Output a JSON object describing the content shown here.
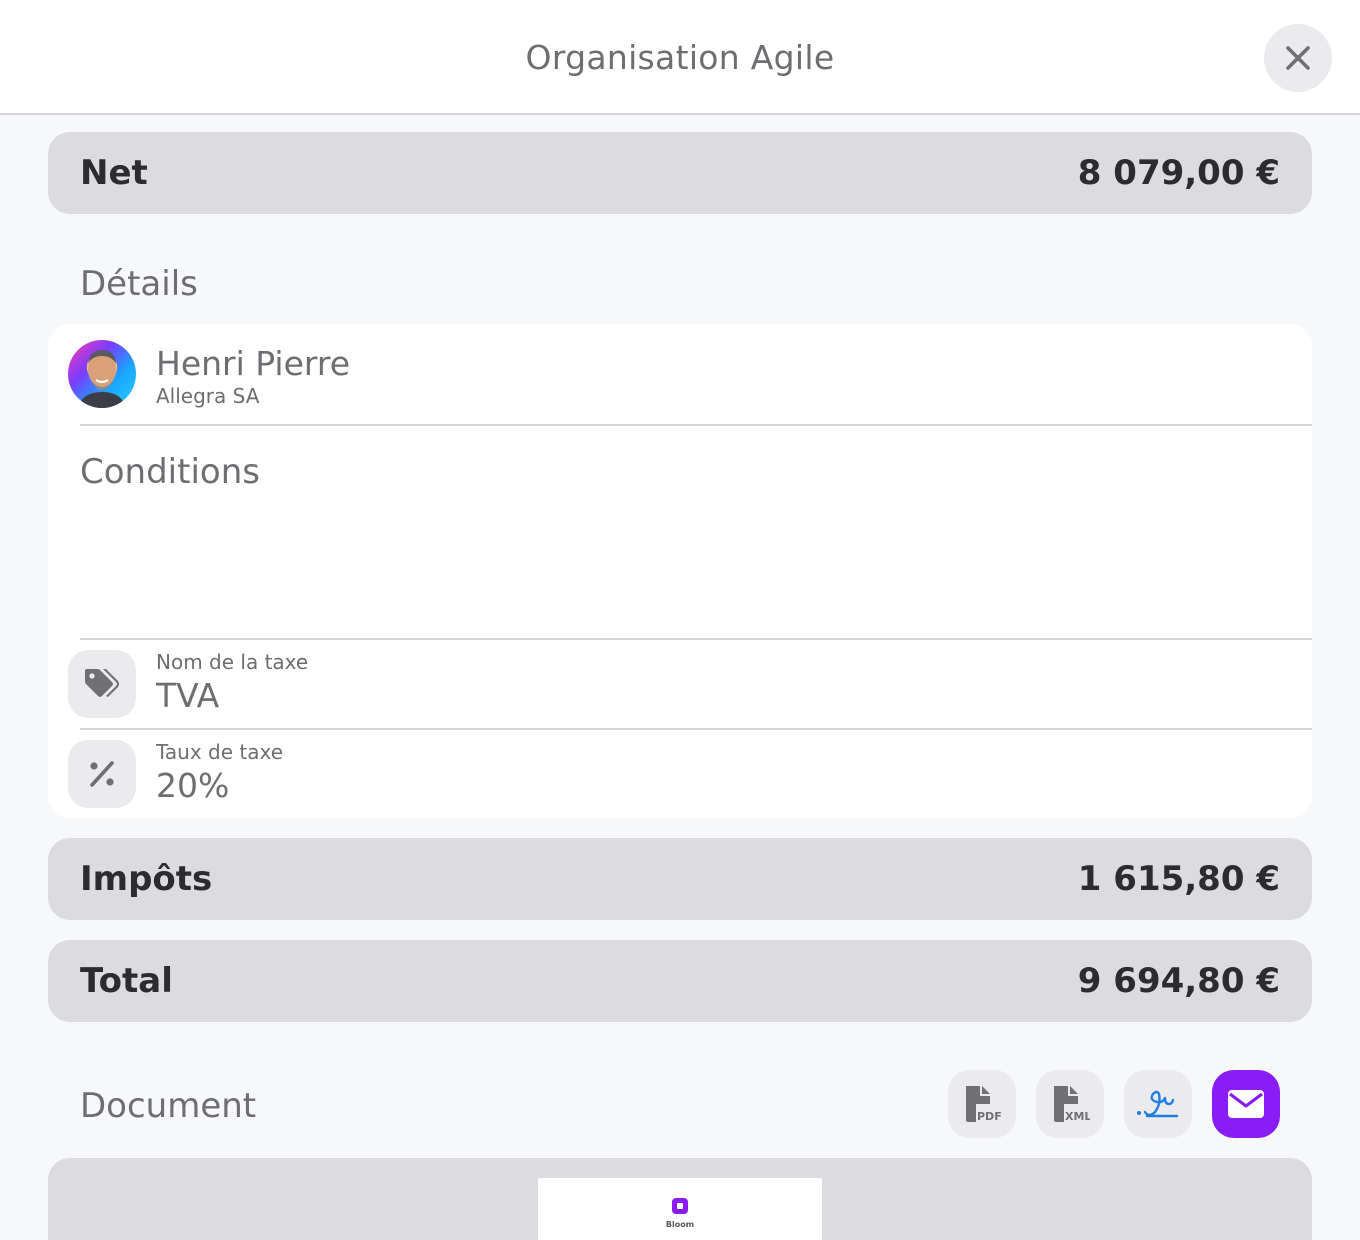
{
  "header": {
    "title": "Organisation Agile",
    "close_icon": "close-icon"
  },
  "net": {
    "label": "Net",
    "value": "8 079,00 €"
  },
  "details": {
    "title": "Détails",
    "contact": {
      "name": "Henri Pierre",
      "company": "Allegra SA"
    },
    "conditions_label": "Conditions",
    "tax_name": {
      "label": "Nom de la taxe",
      "value": "TVA",
      "icon": "tags-icon"
    },
    "tax_rate": {
      "label": "Taux de taxe",
      "value": "20%",
      "icon": "percent-icon"
    }
  },
  "taxes": {
    "label": "Impôts",
    "value": "1 615,80 €"
  },
  "total": {
    "label": "Total",
    "value": "9 694,80 €"
  },
  "document": {
    "title": "Document",
    "actions": [
      {
        "icon": "pdf-file-icon",
        "text": "PDF"
      },
      {
        "icon": "xml-file-icon",
        "text": "XML"
      },
      {
        "icon": "signature-icon"
      },
      {
        "icon": "envelope-icon"
      }
    ],
    "preview_brand": "Bloom"
  },
  "colors": {
    "accent": "#8a1cf5",
    "signature": "#1f7fe0",
    "bar": "#dcdcde"
  }
}
